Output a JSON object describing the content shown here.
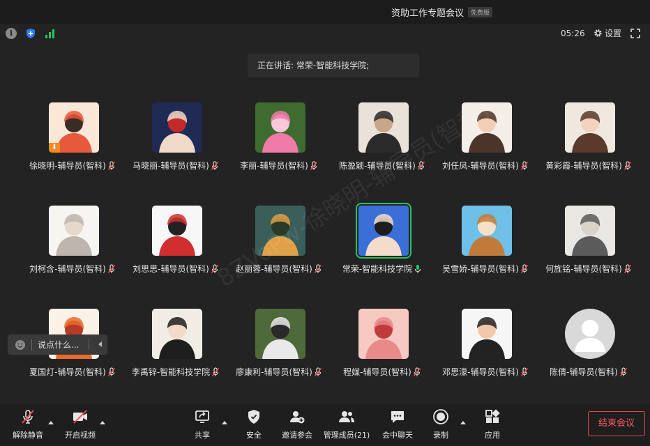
{
  "window": {
    "title": "资助工作专题会议",
    "badge": "免费版"
  },
  "status": {
    "timer": "05:26",
    "settings_label": "设置"
  },
  "speaking": {
    "text": "正在讲话: 常荣-智能科技学院;"
  },
  "watermark": {
    "text": "8ZVoPw-徐晓明-辅导员(智科)"
  },
  "chat": {
    "placeholder": "说点什么..."
  },
  "participants": [
    {
      "name": "徐晓明-辅导员(智科)",
      "muted": true,
      "palette": [
        "#fbe7d8",
        "#e8583a",
        "#3b2b25"
      ]
    },
    {
      "name": "马晓丽-辅导员(智科)",
      "muted": true,
      "palette": [
        "#1f2a55",
        "#f0d9c8",
        "#c22a2a"
      ]
    },
    {
      "name": "李丽-辅导员(智科)",
      "muted": true,
      "palette": [
        "#3e6b2e",
        "#f07aa8",
        "#f8c7d8"
      ]
    },
    {
      "name": "陈盈颖-辅导员(智科)",
      "muted": true,
      "palette": [
        "#e9e2d8",
        "#2a2a2a",
        "#c9a58a"
      ]
    },
    {
      "name": "刘任凤-辅导员(智科)",
      "muted": true,
      "palette": [
        "#f4eee8",
        "#4a3528",
        "#f2cdb8"
      ]
    },
    {
      "name": "黄彩霞-辅导员(智科)",
      "muted": true,
      "palette": [
        "#efe8df",
        "#5a3a2a",
        "#f3d2c0"
      ]
    },
    {
      "name": "刘柯含-辅导员(智科)",
      "muted": true,
      "palette": [
        "#f7f5f2",
        "#bdb5ae",
        "#e6d9cc"
      ]
    },
    {
      "name": "刘思思-辅导员(智科)",
      "muted": true,
      "palette": [
        "#f7f7f7",
        "#d12f2f",
        "#222222"
      ]
    },
    {
      "name": "赵丽蓉-辅导员(智科)",
      "muted": true,
      "palette": [
        "#3a5f5a",
        "#e0a048",
        "#2a3a28"
      ]
    },
    {
      "name": "常荣-智能科技学院",
      "muted": false,
      "active": true,
      "palette": [
        "#3b6fd8",
        "#f2dccc",
        "#1d1d1d"
      ]
    },
    {
      "name": "吴雪娇-辅导员(智科)",
      "muted": true,
      "palette": [
        "#6fc0e8",
        "#c27a3a",
        "#f7e0c8"
      ]
    },
    {
      "name": "何旌铭-辅导员(智科)",
      "muted": true,
      "palette": [
        "#e9e7e2",
        "#5b5b5b",
        "#d9d4c9"
      ]
    },
    {
      "name": "夏国灯-辅导员(智科)",
      "muted": true,
      "palette": [
        "#faf2e6",
        "#e86b2a",
        "#b53a2a"
      ]
    },
    {
      "name": "李禹锌-智能科技学院",
      "muted": true,
      "palette": [
        "#f0ece6",
        "#1e1e1e",
        "#f3d9c6"
      ]
    },
    {
      "name": "廖康利-辅导员(智科)",
      "muted": true,
      "palette": [
        "#4f6a3a",
        "#e9e9e9",
        "#2a2a2a"
      ]
    },
    {
      "name": "程媒-辅导员(智科)",
      "muted": true,
      "palette": [
        "#f6c9c2",
        "#e98a8a",
        "#c23a3a"
      ]
    },
    {
      "name": "邓思濛-辅导员(智科)",
      "muted": true,
      "palette": [
        "#f6f6f6",
        "#222222",
        "#f2c9a8"
      ]
    },
    {
      "name": "陈倩-辅导员(智科)",
      "muted": true,
      "palette": [
        "#d9d9d9",
        "#c8c8c8",
        "#ffffff"
      ]
    }
  ],
  "toolbar": {
    "unmute": "解除静音",
    "start_video": "开启视频",
    "share": "共享",
    "security": "安全",
    "invite": "邀请参会",
    "manage": "管理成员(21)",
    "chat": "会中聊天",
    "record": "录制",
    "apps": "应用",
    "end": "结束会议"
  }
}
